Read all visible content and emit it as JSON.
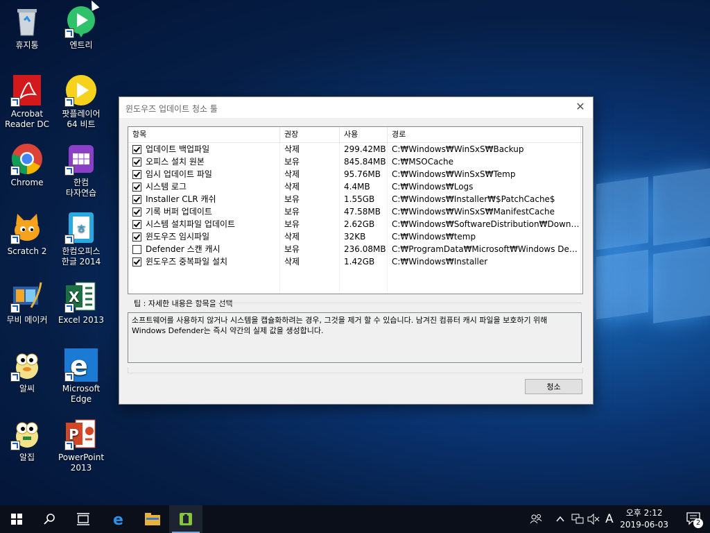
{
  "desktop": {
    "icons": [
      {
        "label": "휴지통",
        "icon": "recycle-bin-icon"
      },
      {
        "label": "엔트리",
        "icon": "entry-icon"
      },
      {
        "label": "Acrobat\nReader DC",
        "icon": "acrobat-icon"
      },
      {
        "label": "팟플레이어\n64 비트",
        "icon": "potplayer-icon"
      },
      {
        "label": "Chrome",
        "icon": "chrome-icon"
      },
      {
        "label": "한컴\n타자연습",
        "icon": "hancom-typing-icon"
      },
      {
        "label": "Scratch 2",
        "icon": "scratch-icon"
      },
      {
        "label": "한컴오피스\n한글 2014",
        "icon": "hwp-icon"
      },
      {
        "label": "무비 메이커",
        "icon": "movie-maker-icon"
      },
      {
        "label": "Excel 2013",
        "icon": "excel-icon"
      },
      {
        "label": "알씨",
        "icon": "alsee-icon"
      },
      {
        "label": "Microsoft\nEdge",
        "icon": "edge-icon"
      },
      {
        "label": "알집",
        "icon": "alzip-icon"
      },
      {
        "label": "PowerPoint\n2013",
        "icon": "powerpoint-icon"
      }
    ]
  },
  "dialog": {
    "title": "윈도우즈 업데이트 청소 툴",
    "columns": [
      "항목",
      "권장",
      "사용",
      "경로"
    ],
    "rows": [
      {
        "checked": true,
        "name": "업데이트 백업파일",
        "rec": "삭제",
        "size": "299.42MB",
        "path": "C:₩Windows₩WinSxS₩Backup"
      },
      {
        "checked": true,
        "name": "오피스 설치 원본",
        "rec": "보유",
        "size": "845.84MB",
        "path": "C:₩MSOCache"
      },
      {
        "checked": true,
        "name": "임시 업데이트 파일",
        "rec": "삭제",
        "size": "95.76MB",
        "path": "C:₩Windows₩WinSxS₩Temp"
      },
      {
        "checked": true,
        "name": "시스템 로그",
        "rec": "삭제",
        "size": "4.4MB",
        "path": "C:₩Windows₩Logs"
      },
      {
        "checked": true,
        "name": "Installer CLR 캐쉬",
        "rec": "보유",
        "size": "1.55GB",
        "path": "C:₩Windows₩Installer₩$PatchCache$"
      },
      {
        "checked": true,
        "name": "기록 버퍼 업데이트",
        "rec": "보유",
        "size": "47.58MB",
        "path": "C:₩Windows₩WinSxS₩ManifestCache"
      },
      {
        "checked": true,
        "name": "시스템 설치파일 업데이트",
        "rec": "보유",
        "size": "2.62GB",
        "path": "C:₩Windows₩SoftwareDistribution₩Download"
      },
      {
        "checked": true,
        "name": "윈도우즈 임시파일",
        "rec": "삭제",
        "size": "32KB",
        "path": "C:₩Windows₩temp"
      },
      {
        "checked": false,
        "name": "Defender 스캔 캐시",
        "rec": "보유",
        "size": "236.08MB",
        "path": "C:₩ProgramData₩Microsoft₩Windows Defen..."
      },
      {
        "checked": true,
        "name": "윈도우즈 중복파일 설치",
        "rec": "삭제",
        "size": "1.42GB",
        "path": "C:₩Windows₩Installer"
      }
    ],
    "tip_label": "팁 : 자세한 내용은 항목을 선택",
    "tip_text": "소프트웨어를 사용하지 않거나 시스템을 캡슐화하려는 경우, 그것을 제거 할 수 있습니다. 남겨진 컴퓨터 캐시 파일을 보호하기 위해\nWindows Defender는 즉시 약간의 실제 값을 생성합니다.",
    "clean_button": "청소"
  },
  "taskbar": {
    "ime": "A",
    "time": "오후 2:12",
    "date": "2019-06-03",
    "notifications": "2"
  }
}
